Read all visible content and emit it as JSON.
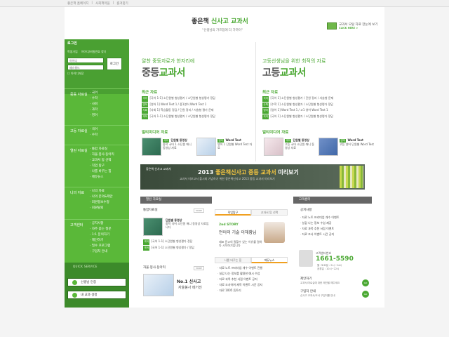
{
  "top_links": [
    "좋은책 홈페이지",
    "사회책마을",
    "즐겨찾기"
  ],
  "header": {
    "logo_prefix": "좋은책",
    "logo_main": "신사고 교과서",
    "slogan": "\"선생님의 가르침에 더 가까이\"",
    "link_text": "교과서 오탈 자료 한눈에 보기",
    "link_more": "CLICK HERE >"
  },
  "login": {
    "title": "로그인",
    "opt1": "학생가입",
    "opt2": "아이디/비밀번호 찾기",
    "id_value": "아이디",
    "pw_value": "패스워드",
    "button": "로그인",
    "check": "아이디저장"
  },
  "nav": [
    {
      "head": "중등 자료실",
      "items": [
        "국어",
        "수학",
        "사회",
        "과학",
        "영어"
      ]
    },
    {
      "head": "고등 자료실",
      "items": [
        "국어",
        "수학"
      ]
    },
    {
      "head": "열린 자료실",
      "items": [
        "통합 자료실",
        "자율·봉사·동아리",
        "교과서 탐 선택",
        "직업 탐구",
        "나를 바꾸는 힘",
        "에듀뉴스"
      ]
    },
    {
      "head": "나의 자료",
      "items": [
        "나의 자료",
        "나의 문의&제안",
        "회원정보수정",
        "회원탈퇴"
      ]
    },
    {
      "head": "고객센터",
      "items": [
        "공지사항",
        "자주 묻는 질문",
        "1:1 문의하기",
        "제안하기",
        "필수 프로그램",
        "구입처 안내"
      ]
    }
  ],
  "quick": {
    "title": "QUICK SERVICE",
    "btn1": "선생님 인증",
    "btn2": "내 교과 설정"
  },
  "middle": {
    "sub": "알찬 중등자료가 한자리에",
    "title_a": "중등",
    "title_b": "교과서",
    "recent_head": "최근 자료",
    "recent": [
      {
        "tag": "국어",
        "text": "[국어 1-1] 소단원별 형성평가 / 소단원별 형성평가 정답"
      },
      {
        "tag": "영어",
        "text": "[영어 1] Word Test 1 / 중1영어 Word Test 1"
      },
      {
        "tag": "사회",
        "text": "[사회 1] 학습활동 정답 / 단원 정리 / 서술형 평가 문제"
      },
      {
        "tag": "국어",
        "text": "[국어 1-1] 소단원별 형성평가 / 소단원별 형성평가 정답"
      }
    ],
    "media_head": "멀티미디어 자료",
    "media": [
      {
        "tag": "국어",
        "title": "단원별 동영상",
        "desc": "중학 국어 1 소단원 애니 동영상 자료"
      },
      {
        "tag": "영어",
        "title": "Word Test",
        "desc": "영어 1 단원별 Word Test 자료"
      }
    ]
  },
  "right": {
    "sub": "고등선생님을 위한 최적의 자료",
    "title_a": "고등",
    "title_b": "교과서",
    "recent_head": "최근 자료",
    "recent": [
      {
        "tag": "국어",
        "text": "[국어 1] 소단원별 형성평가 / 단원 정리 / 서술형 문제"
      },
      {
        "tag": "수학",
        "text": "[수학 1] 소단원별 형성평가 / 소단원별 형성평가 정답"
      },
      {
        "tag": "영어",
        "text": "[영어 1] Word Test 1 / 고1 영어 Word Test 1"
      },
      {
        "tag": "국어",
        "text": "[국어 1] 소단원별 형성평가 / 소단원별 형성평가 정답"
      }
    ],
    "media_head": "멀티미디어 자료",
    "media": [
      {
        "tag": "국어",
        "title": "단원별 동영상",
        "desc": "고등 국어 소단원 애니 동영상 자료"
      },
      {
        "tag": "영어",
        "title": "Word Test",
        "desc": "고등 영어 단원별 Word Test"
      }
    ]
  },
  "banner": {
    "small": "좋은책 신사고 교과서",
    "title_a": "2013 ",
    "title_b": "좋은책신사고 중등 교과서",
    "title_c": " 미리보기",
    "sub": "교과서 미보고서 출시회 기념하기 위한 좋은책신사고 2013 중등 교과서 미리보기"
  },
  "open_box": {
    "header": "열린 자료실",
    "sec1": "통합자료실",
    "item_title": "단원별 동영상",
    "item_desc": "중학 국어 소단원 애니 동영상 자료입니다",
    "rows": [
      {
        "tag": "국어",
        "text": "[국어 1-1] 소단원별 형성평가 정답"
      },
      {
        "tag": "국어",
        "text": "[국어 1-1] 소단원별 형성평가 / 정답"
      }
    ],
    "sec2": "자율·봉사·동아리",
    "no1": "No.1 신사고",
    "no1_sub": "자율봉사 메거진",
    "more": "MORE"
  },
  "center_box": {
    "tab1": "직업탐구",
    "tab2": "교과서 탐 선택",
    "story_head": "2nd STORY",
    "story_title": "언어의 기술 이해황님",
    "story_desc": "대표 문고의 말할수 있는 이유를 말하다 시작하기입니다",
    "tab3": "나를 바꾸는 힘",
    "tab4": "에듀뉴스",
    "news": [
      "자료 노트 프리미엄 개수 이벤트 진행",
      "실감 나는 정보를 활용한 예시 수업",
      "자료 과목 추천 서점 이벤트 공지",
      "자료 조사하여 제작 이벤트 시간 공지",
      "자료 1005 튜토리"
    ]
  },
  "service_box": {
    "header": "고객센터",
    "notice_head": "공지사항",
    "notices": [
      "자료 노트 프리미엄 개수 이벤트",
      "실감 나는 정보 수업 제공",
      "자료 과목 추천 서점 이벤트",
      "자료 조사 이벤트 시간 공지"
    ],
    "call_label": "고객센터번호",
    "phone": "1661-5590",
    "hours": "월~토요일 : 9시~24시",
    "hours2": "공휴일 : 10시~22시",
    "suggest_head": "제안하기",
    "suggest_desc": "교과서/자료실에 대한 제안을 해주세요",
    "where_head": "구입처 안내",
    "where_desc": "신사고 교과서/도서 구입처를 안내",
    "go": "GO"
  }
}
